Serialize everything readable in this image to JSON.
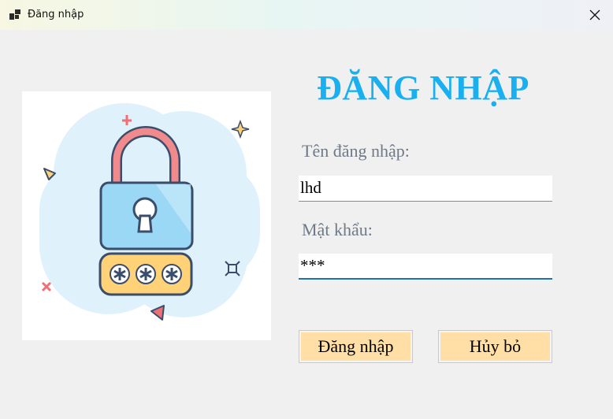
{
  "window": {
    "title": "Đăng nhập",
    "app_icon": "windows-form-icon",
    "close_icon": "close-icon"
  },
  "form": {
    "heading": "ĐĂNG NHẬP",
    "username_label": "Tên đăng nhập:",
    "username_value": "lhd",
    "password_label": "Mật khẩu:",
    "password_value": "***",
    "login_button": "Đăng nhập",
    "cancel_button": "Hủy bỏ"
  },
  "illustration": {
    "icon": "padlock-icon",
    "mask": "***"
  },
  "colors": {
    "heading": "#1ab0f0",
    "button_bg": "#ffdfa6",
    "window_bg": "#f0f0f0",
    "focus_underline": "#1f6fb8"
  }
}
